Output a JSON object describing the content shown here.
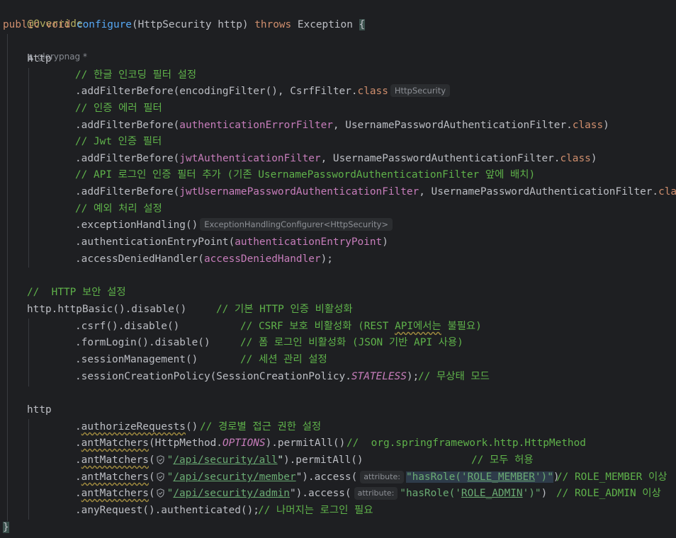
{
  "editor": {
    "annotation": "@Override",
    "author": "glorypnag *",
    "signature": {
      "modifiers": "public void ",
      "method": "configure",
      "params": "(HttpSecurity http) ",
      "throws_kw": "throws",
      "exception": " Exception ",
      "brace": "{"
    },
    "closing_brace": "}",
    "hints": {
      "http_security": "HttpSecurity",
      "exception_configurer": "ExceptionHandlingConfigurer<HttpSecurity>",
      "attribute": "attribute:"
    },
    "block1": {
      "http": "http",
      "c_encoding": "// 한글 인코딩 필터 설정",
      "add1_pre": ".addFilterBefore(encodingFilter(), CsrfFilter.",
      "class_kw": "class",
      "c_auth_error": "// 인증 에러 필터",
      "add_pre": ".addFilterBefore(",
      "authErrorFilter": "authenticationErrorFilter",
      "upaf_suffix": ", UsernamePasswordAuthenticationFilter.",
      "close_paren": ")",
      "c_jwt": "// Jwt 인증 필터",
      "jwtFilter": "jwtAuthenticationFilter",
      "c_api_login": "// API 로그인 인증 필터 추가 (기존 UsernamePasswordAuthenticationFilter 앞에 배치)",
      "jwtUserFilter": "jwtUsernamePasswordAuthenticationFilter",
      "c_exception": "// 예외 처리 설정",
      "exception_handling": ".exceptionHandling()",
      "entry_pre": ".authenticationEntryPoint(",
      "entry_field": "authenticationEntryPoint",
      "denied_pre": ".accessDeniedHandler(",
      "denied_field": "accessDeniedHandler",
      "end": ");"
    },
    "block2": {
      "c_http_security": "//  HTTP 보안 설정",
      "httpBasic": "http.httpBasic().disable()",
      "c_httpBasic": "// 기본 HTTP 인증 비활성화",
      "csrf": ".csrf().disable()",
      "c_csrf_1": "// CSRF 보호 비활성화 (REST ",
      "c_csrf_api": "API에서는",
      "c_csrf_2": " 불필요)",
      "formLogin": ".formLogin().disable()",
      "c_formLogin": "// 폼 로그인 비활성화 (JSON 기반 API 사용)",
      "sessionMgmt": ".sessionManagement()",
      "c_session": "// 세션 관리 설정",
      "policy_pre": ".sessionCreationPolicy(SessionCreationPolicy.",
      "stateless": "STATELESS",
      "policy_end": ");",
      "c_stateless": "// 무상태 모드"
    },
    "block3": {
      "http": "http",
      "dot": ".",
      "authorize": "authorizeRequests",
      "authorize_end": "()",
      "c_authorize": "// 경로별 접근 권한 설정",
      "ant": "antMatchers",
      "options_pre": "(HttpMethod.",
      "options": "OPTIONS",
      "options_end": ").permitAll()",
      "c_options": "//  org.springframework.http.HttpMethod",
      "open_paren": "(",
      "quote": "\"",
      "path_all": "/api/security/all",
      "permit_end": "\").permitAll()",
      "c_permit": "// 모두 허용",
      "path_member": "/api/security/member",
      "access_mid": "\").access(",
      "has_role_pre": "\"hasRole('",
      "role_member": "ROLE_MEMBER",
      "has_role_end": "')\"",
      "close": ")",
      "c_member": "// ROLE_MEMBER 이상",
      "path_admin": "/api/security/admin",
      "role_admin": "ROLE_ADMIN",
      "c_admin": "// ROLE_ADMIN 이상",
      "any_request": ".anyRequest().authenticated();",
      "c_rest": "// 나머지는 로그인 필요"
    }
  }
}
